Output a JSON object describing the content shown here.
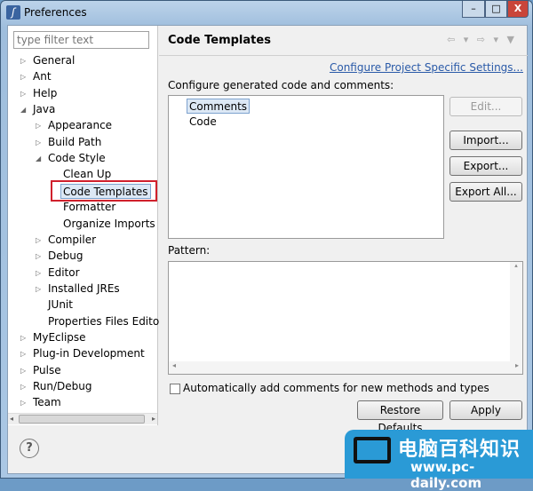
{
  "window": {
    "title": "Preferences",
    "minimize": "–",
    "maximize": "□",
    "close": "X"
  },
  "filter": {
    "placeholder": "type filter text"
  },
  "tree": [
    {
      "label": "General",
      "level": 0,
      "twisty": "▷"
    },
    {
      "label": "Ant",
      "level": 0,
      "twisty": "▷"
    },
    {
      "label": "Help",
      "level": 0,
      "twisty": "▷"
    },
    {
      "label": "Java",
      "level": 0,
      "twisty": "◢"
    },
    {
      "label": "Appearance",
      "level": 1,
      "twisty": "▷"
    },
    {
      "label": "Build Path",
      "level": 1,
      "twisty": "▷"
    },
    {
      "label": "Code Style",
      "level": 1,
      "twisty": "◢"
    },
    {
      "label": "Clean Up",
      "level": 2,
      "twisty": ""
    },
    {
      "label": "Code Templates",
      "level": 2,
      "twisty": "",
      "selected": true
    },
    {
      "label": "Formatter",
      "level": 2,
      "twisty": ""
    },
    {
      "label": "Organize Imports",
      "level": 2,
      "twisty": ""
    },
    {
      "label": "Compiler",
      "level": 1,
      "twisty": "▷"
    },
    {
      "label": "Debug",
      "level": 1,
      "twisty": "▷"
    },
    {
      "label": "Editor",
      "level": 1,
      "twisty": "▷"
    },
    {
      "label": "Installed JREs",
      "level": 1,
      "twisty": "▷"
    },
    {
      "label": "JUnit",
      "level": 1,
      "twisty": ""
    },
    {
      "label": "Properties Files Edito",
      "level": 1,
      "twisty": ""
    },
    {
      "label": "MyEclipse",
      "level": 0,
      "twisty": "▷"
    },
    {
      "label": "Plug-in Development",
      "level": 0,
      "twisty": "▷"
    },
    {
      "label": "Pulse",
      "level": 0,
      "twisty": "▷"
    },
    {
      "label": "Run/Debug",
      "level": 0,
      "twisty": "▷"
    },
    {
      "label": "Team",
      "level": 0,
      "twisty": "▷"
    }
  ],
  "page": {
    "title": "Code Templates",
    "nav": "⇦ ▾ ⇨ ▾ ▼",
    "configure_link": "Configure Project Specific Settings...",
    "configure_label": "Configure generated code and comments:",
    "templates": [
      "Comments",
      "Code"
    ],
    "buttons": {
      "edit": "Edit...",
      "import": "Import...",
      "export": "Export...",
      "export_all": "Export All..."
    },
    "pattern_label": "Pattern:",
    "auto_comments_label": "Automatically add comments for new methods and types",
    "auto_comments_checked": false,
    "restore_defaults": "Restore Defaults",
    "apply": "Apply"
  },
  "help_icon": "?",
  "watermark": {
    "title": "电脑百科知识",
    "url": "www.pc-daily.com"
  },
  "colors": {
    "highlight": "#d0202c",
    "link": "#2a5aa8",
    "watermark": "#2a9ad6"
  }
}
